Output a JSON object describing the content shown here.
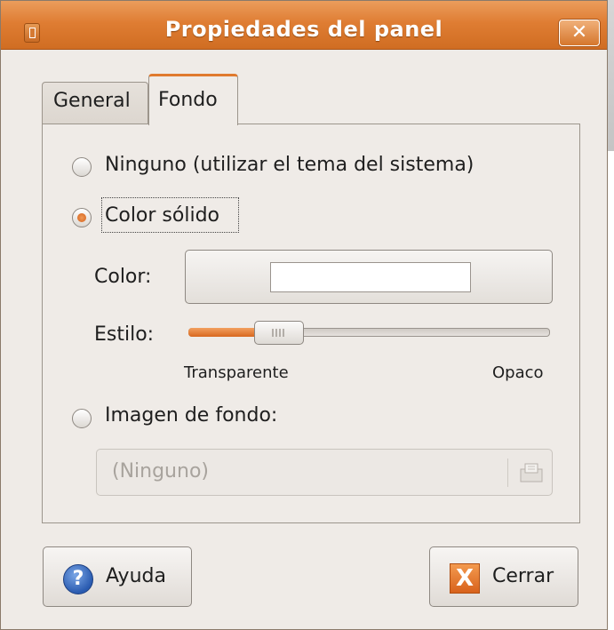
{
  "window": {
    "title": "Propiedades del panel",
    "close_glyph": "✕"
  },
  "tabs": [
    {
      "label": "General",
      "selected": false
    },
    {
      "label": "Fondo",
      "selected": true
    }
  ],
  "background": {
    "options": [
      {
        "label": "Ninguno (utilizar el tema del sistema)",
        "selected": false
      },
      {
        "label": "Color sólido",
        "selected": true
      },
      {
        "label": "Imagen de fondo:",
        "selected": false
      }
    ],
    "color_label": "Color:",
    "color_value": "#ffffff",
    "style_label": "Estilo:",
    "style_level": 0.12,
    "style_min_label": "Transparente",
    "style_max_label": "Opaco",
    "image_file": "(Ninguno)"
  },
  "buttons": {
    "help": {
      "label": "Ayuda",
      "icon": "help-icon",
      "glyph": "?"
    },
    "close": {
      "label": "Cerrar",
      "icon": "close-icon",
      "glyph": "X"
    }
  },
  "colors": {
    "accent": "#df7d33",
    "dialog_bg": "#efebe7"
  }
}
